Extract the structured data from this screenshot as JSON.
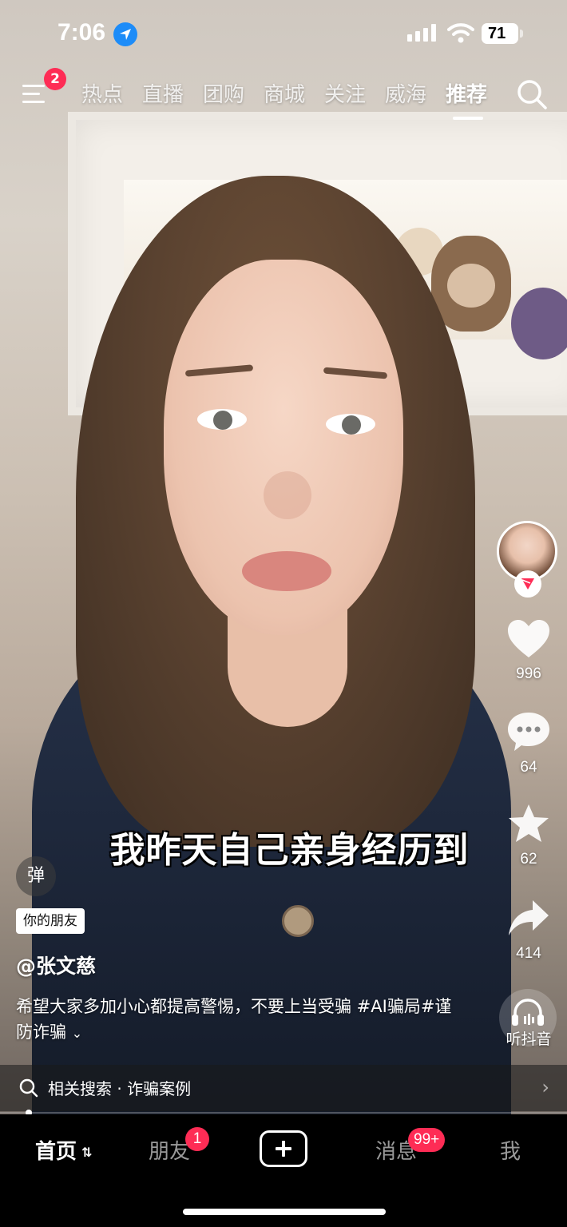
{
  "status_bar": {
    "time": "7:06",
    "battery": "71"
  },
  "top_nav": {
    "menu_badge": "2",
    "tabs": [
      {
        "label": "热点"
      },
      {
        "label": "直播"
      },
      {
        "label": "团购"
      },
      {
        "label": "商城"
      },
      {
        "label": "关注"
      },
      {
        "label": "威海"
      },
      {
        "label": "推荐"
      }
    ],
    "active_tab": "推荐"
  },
  "video": {
    "subtitle": "我昨天自己亲身经历到",
    "danmaku_label": "弹",
    "friend_tag": "你的朋友",
    "author": "@张文慈",
    "description": "希望大家多加小心都提高警惕，不要上当受骗 #AI骗局#谨防诈骗",
    "expand_symbol": "⌄"
  },
  "actions": {
    "likes": "996",
    "comments": "64",
    "favorites": "62",
    "shares": "414",
    "listen_label": "听抖音"
  },
  "related_search": {
    "text": "相关搜索 · 诈骗案例",
    "arrow": "›"
  },
  "bottom_nav": {
    "home": "首页",
    "friends": "朋友",
    "friends_badge": "1",
    "messages": "消息",
    "messages_badge": "99+",
    "me": "我"
  },
  "colors": {
    "accent": "#fe2c55",
    "location_blue": "#1d8cf8"
  }
}
